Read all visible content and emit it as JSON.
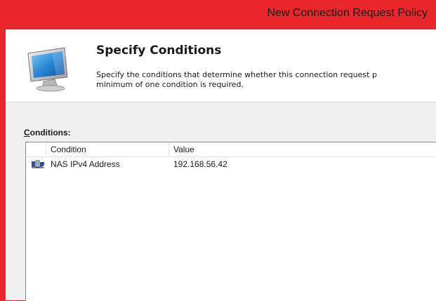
{
  "window": {
    "title": "New Connection Request Policy"
  },
  "header": {
    "title": "Specify Conditions",
    "description_line1": "Specify the conditions that determine whether this connection request p",
    "description_line2": "minimum of one condition is required."
  },
  "conditions": {
    "label_accel": "C",
    "label_rest": "onditions:",
    "columns": [
      "",
      "Condition",
      "Value"
    ],
    "rows": [
      {
        "icon": "network-address-icon",
        "condition": "NAS IPv4 Address",
        "value": "192.168.56.42"
      }
    ]
  },
  "colors": {
    "frame": "#e8262b",
    "client": "#ffffff",
    "body": "#f0f0f0"
  }
}
